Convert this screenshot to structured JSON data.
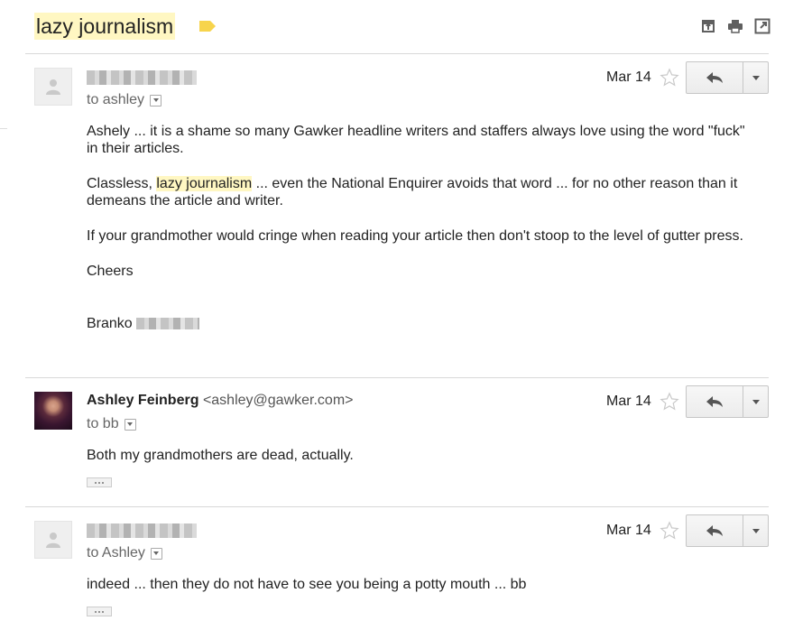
{
  "thread": {
    "subject": "lazy journalism",
    "label_color": "#f7d44c",
    "highlight_color": "#fff7c2"
  },
  "top_actions": [
    "archive-icon",
    "print-icon",
    "new-window-icon"
  ],
  "messages": [
    {
      "sender_name": "",
      "sender_email": "",
      "to": "to ashley",
      "date": "Mar 14",
      "body": {
        "p1": "Ashely ... it is a shame so many Gawker headline writers and staffers always love using the word \"fuck\" in their articles.",
        "p2_before": "Classless, ",
        "p2_highlight": "lazy journalism",
        "p2_after": " ... even the National Enquirer avoids that word ... for no other reason than it demeans the article and writer.",
        "p3": "If your grandmother would cringe when reading your article then don't stoop to the level of gutter press.",
        "p4": "Cheers",
        "signature": "Branko"
      }
    },
    {
      "sender_name": "Ashley Feinberg",
      "sender_email": "<ashley@gawker.com>",
      "to": "to bb",
      "date": "Mar 14",
      "body": {
        "p1": "Both my grandmothers are dead, actually."
      }
    },
    {
      "sender_name": "",
      "sender_email": "",
      "to": "to Ashley",
      "date": "Mar 14",
      "body": {
        "p1": "indeed ... then they do not have to see you being a potty mouth ... bb"
      }
    }
  ]
}
